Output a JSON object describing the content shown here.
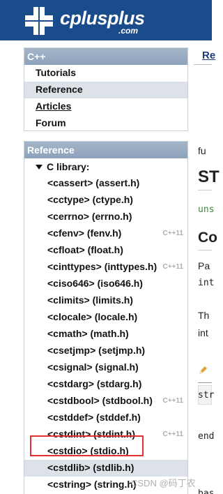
{
  "header": {
    "logo_word": "cplusplus",
    "logo_domain": ".com",
    "logo_icon": "plus-cross-logo-icon",
    "bg_color": "#1a4b8a"
  },
  "sidebar": {
    "section1": {
      "title": "C++",
      "items": [
        {
          "label": "Tutorials",
          "active": false,
          "underlined": false
        },
        {
          "label": "Reference",
          "active": true,
          "underlined": false
        },
        {
          "label": "Articles",
          "active": false,
          "underlined": true
        },
        {
          "label": "Forum",
          "active": false,
          "underlined": false
        }
      ]
    },
    "section2": {
      "title": "Reference",
      "tree_root": "C library:",
      "libs": [
        {
          "label": "<cassert> (assert.h)",
          "badge": ""
        },
        {
          "label": "<cctype> (ctype.h)",
          "badge": ""
        },
        {
          "label": "<cerrno> (errno.h)",
          "badge": ""
        },
        {
          "label": "<cfenv> (fenv.h)",
          "badge": "C++11"
        },
        {
          "label": "<cfloat> (float.h)",
          "badge": ""
        },
        {
          "label": "<cinttypes> (inttypes.h)",
          "badge": "C++11"
        },
        {
          "label": "<ciso646> (iso646.h)",
          "badge": ""
        },
        {
          "label": "<climits> (limits.h)",
          "badge": ""
        },
        {
          "label": "<clocale> (locale.h)",
          "badge": ""
        },
        {
          "label": "<cmath> (math.h)",
          "badge": ""
        },
        {
          "label": "<csetjmp> (setjmp.h)",
          "badge": ""
        },
        {
          "label": "<csignal> (signal.h)",
          "badge": ""
        },
        {
          "label": "<cstdarg> (stdarg.h)",
          "badge": ""
        },
        {
          "label": "<cstdbool> (stdbool.h)",
          "badge": "C++11"
        },
        {
          "label": "<cstddef> (stddef.h)",
          "badge": ""
        },
        {
          "label": "<cstdint> (stdint.h)",
          "badge": "C++11"
        },
        {
          "label": "<cstdio> (stdio.h)",
          "badge": ""
        },
        {
          "label": "<cstdlib> (stdlib.h)",
          "badge": "",
          "selected": true
        },
        {
          "label": "<cstring> (string.h)",
          "badge": ""
        }
      ]
    }
  },
  "main": {
    "top_link": "Re",
    "func_text": "fu",
    "big_title": "ST",
    "unsigned_frag": "uns",
    "section_title": "Co",
    "para1_line1": "Pa",
    "para1_line2": "int",
    "para2_line1": "Th",
    "para2_line2": "int",
    "code1": "str",
    "code2": "end",
    "code3": "bas"
  },
  "watermark": "CSDN @码丁农"
}
